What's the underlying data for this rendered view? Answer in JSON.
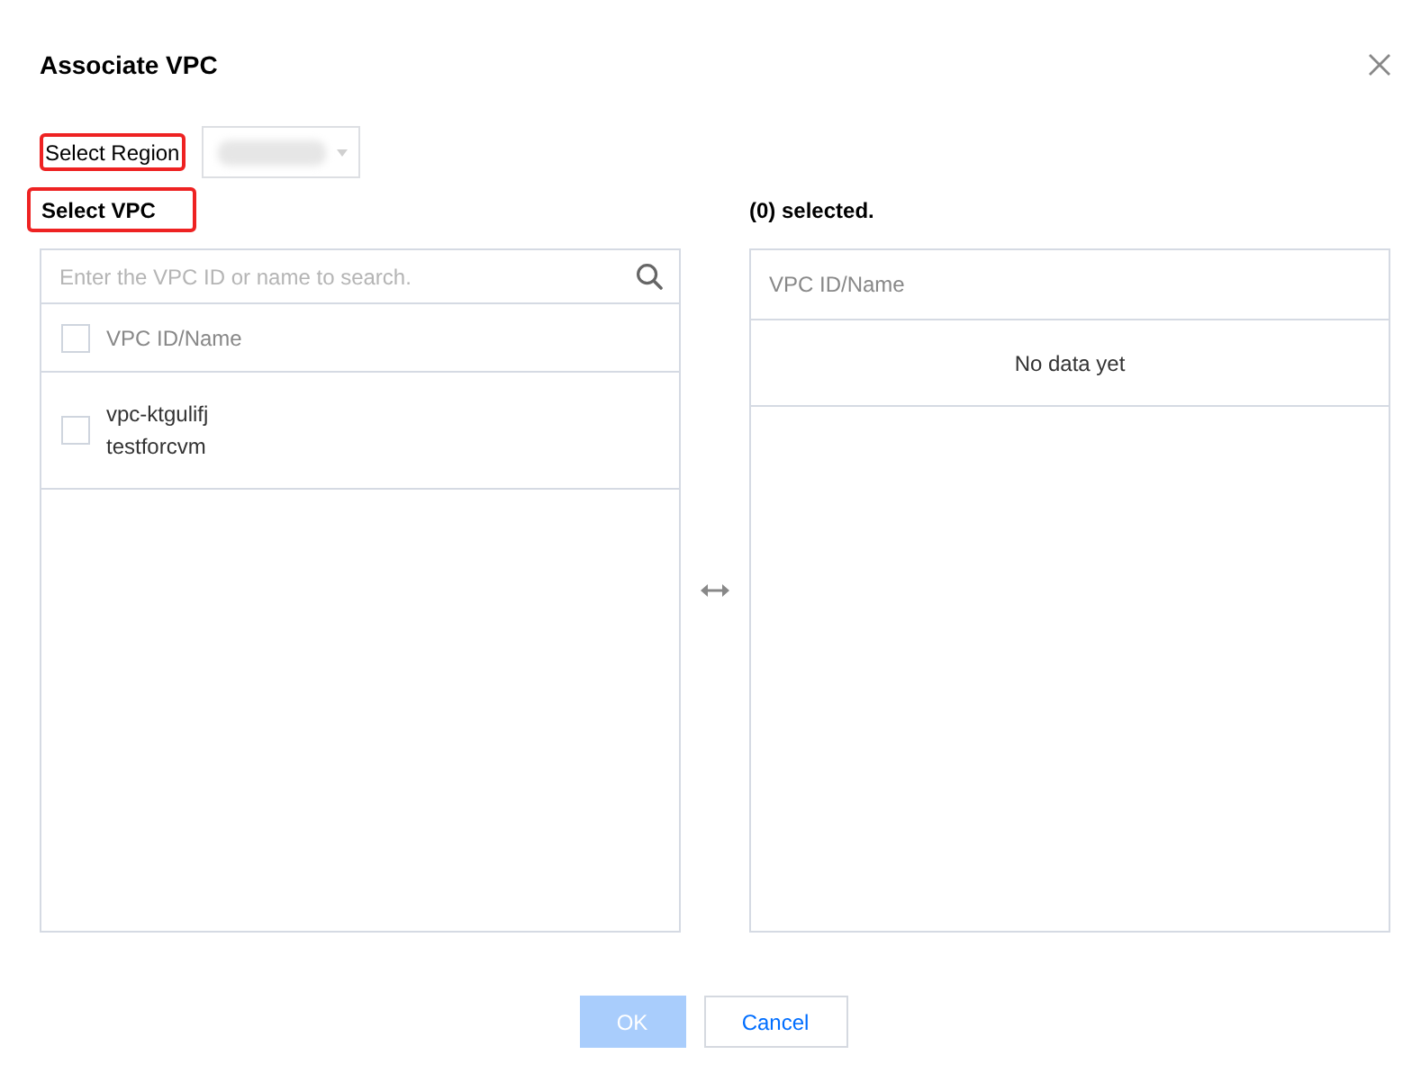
{
  "dialog": {
    "title": "Associate VPC"
  },
  "region": {
    "label": "Select Region",
    "highlighted": true
  },
  "vpc_section": {
    "label": "Select VPC",
    "highlighted": true,
    "search": {
      "placeholder": "Enter the VPC ID or name to search."
    },
    "header": {
      "label": "VPC ID/Name",
      "checked": false
    },
    "rows": [
      {
        "id": "vpc-ktgulifj",
        "name": "testforcvm",
        "checked": false
      }
    ]
  },
  "selected_section": {
    "label": "(0) selected.",
    "column": "VPC ID/Name",
    "empty_text": "No data yet"
  },
  "buttons": [
    {
      "label": "OK",
      "kind": "primary",
      "disabled": true
    },
    {
      "label": "Cancel",
      "kind": "secondary",
      "disabled": false
    }
  ]
}
